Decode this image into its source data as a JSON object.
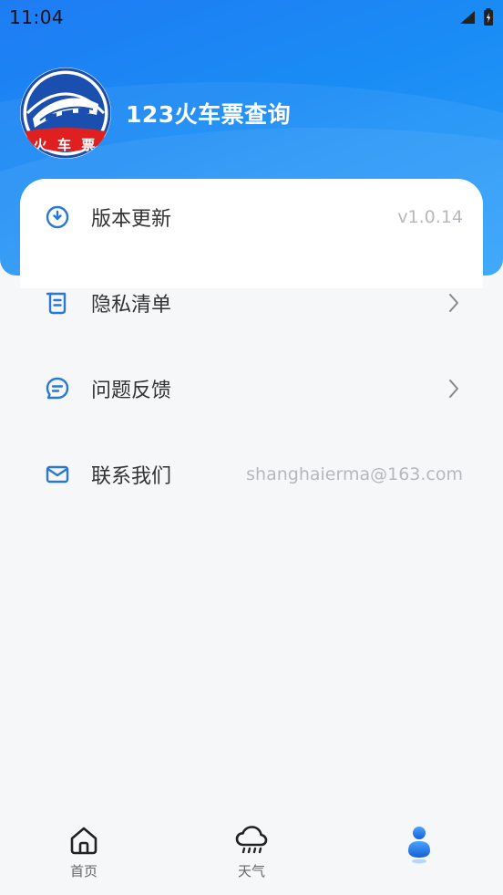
{
  "status_bar": {
    "time": "11:04"
  },
  "header": {
    "title": "123火车票查询",
    "logo_text": "火 车 票"
  },
  "menu": [
    {
      "id": "version",
      "label": "版本更新",
      "value": "v1.0.14",
      "icon": "clock-icon"
    },
    {
      "id": "privacy",
      "label": "隐私清单",
      "icon": "document-icon"
    },
    {
      "id": "feedback",
      "label": "问题反馈",
      "icon": "chat-icon"
    },
    {
      "id": "contact",
      "label": "联系我们",
      "value": "shanghaierma@163.com",
      "icon": "mail-icon"
    }
  ],
  "tabs": [
    {
      "label": "首页",
      "icon": "home-icon"
    },
    {
      "label": "天气",
      "icon": "cloud-rain-icon"
    },
    {
      "label": "",
      "icon": "user-icon",
      "active": true
    }
  ],
  "colors": {
    "primary": "#1a86f4",
    "icon_blue": "#2a78d6"
  }
}
